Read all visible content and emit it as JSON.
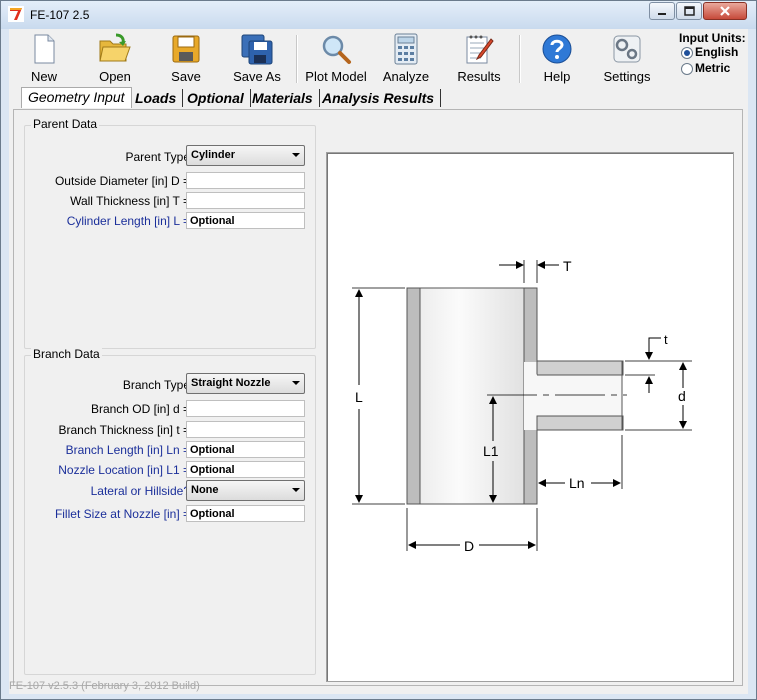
{
  "window": {
    "title": "FE-107 2.5",
    "app_icon_glyph": "7"
  },
  "toolbar": {
    "buttons": [
      {
        "label": "New",
        "icon": "new-document-icon"
      },
      {
        "label": "Open",
        "icon": "open-folder-icon"
      },
      {
        "label": "Save",
        "icon": "save-disk-icon"
      },
      {
        "label": "Save As",
        "icon": "save-as-disk-icon"
      },
      {
        "label": "Plot Model",
        "icon": "magnifier-icon"
      },
      {
        "label": "Analyze",
        "icon": "calculator-icon"
      },
      {
        "label": "Results",
        "icon": "notepad-icon"
      },
      {
        "label": "Help",
        "icon": "help-icon"
      },
      {
        "label": "Settings",
        "icon": "settings-icon"
      }
    ]
  },
  "units": {
    "heading": "Input Units:",
    "options": [
      {
        "label": "English",
        "selected": true
      },
      {
        "label": "Metric",
        "selected": false
      }
    ]
  },
  "tabs": [
    {
      "label": "Geometry Input",
      "active": true
    },
    {
      "label": "Loads",
      "active": false
    },
    {
      "label": "Optional",
      "active": false
    },
    {
      "label": "Materials",
      "active": false
    },
    {
      "label": "Analysis Results",
      "active": false
    }
  ],
  "parent": {
    "title": "Parent Data",
    "type_label": "Parent Type",
    "type_value": "Cylinder",
    "od_label": "Outside Diameter [in]   D =",
    "od_value": "",
    "wall_label": "Wall Thickness [in]   T =",
    "wall_value": "",
    "length_label": "Cylinder Length [in]   L =",
    "length_value": "Optional"
  },
  "branch": {
    "title": "Branch Data",
    "type_label": "Branch Type",
    "type_value": "Straight Nozzle",
    "od_label": "Branch OD [in]   d =",
    "od_value": "",
    "thick_label": "Branch Thickness [in]   t =",
    "thick_value": "",
    "length_label": "Branch Length [in]   Ln =",
    "length_value": "Optional",
    "location_label": "Nozzle Location [in]   L1 =",
    "location_value": "Optional",
    "lateral_label": "Lateral or Hillside?",
    "lateral_value": "None",
    "fillet_label": "Fillet Size at Nozzle [in] =",
    "fillet_value": "Optional"
  },
  "diagram": {
    "labels": {
      "T": "T",
      "t": "t",
      "L": "L",
      "d": "d",
      "L1": "L1",
      "Ln": "Ln",
      "D": "D"
    }
  },
  "status": {
    "text": "FE-107 v2.5.3 (February 3, 2012 Build)"
  },
  "colors": {
    "accent_blue": "#1b2f9a",
    "selected_radio": "#1e4f9a"
  }
}
